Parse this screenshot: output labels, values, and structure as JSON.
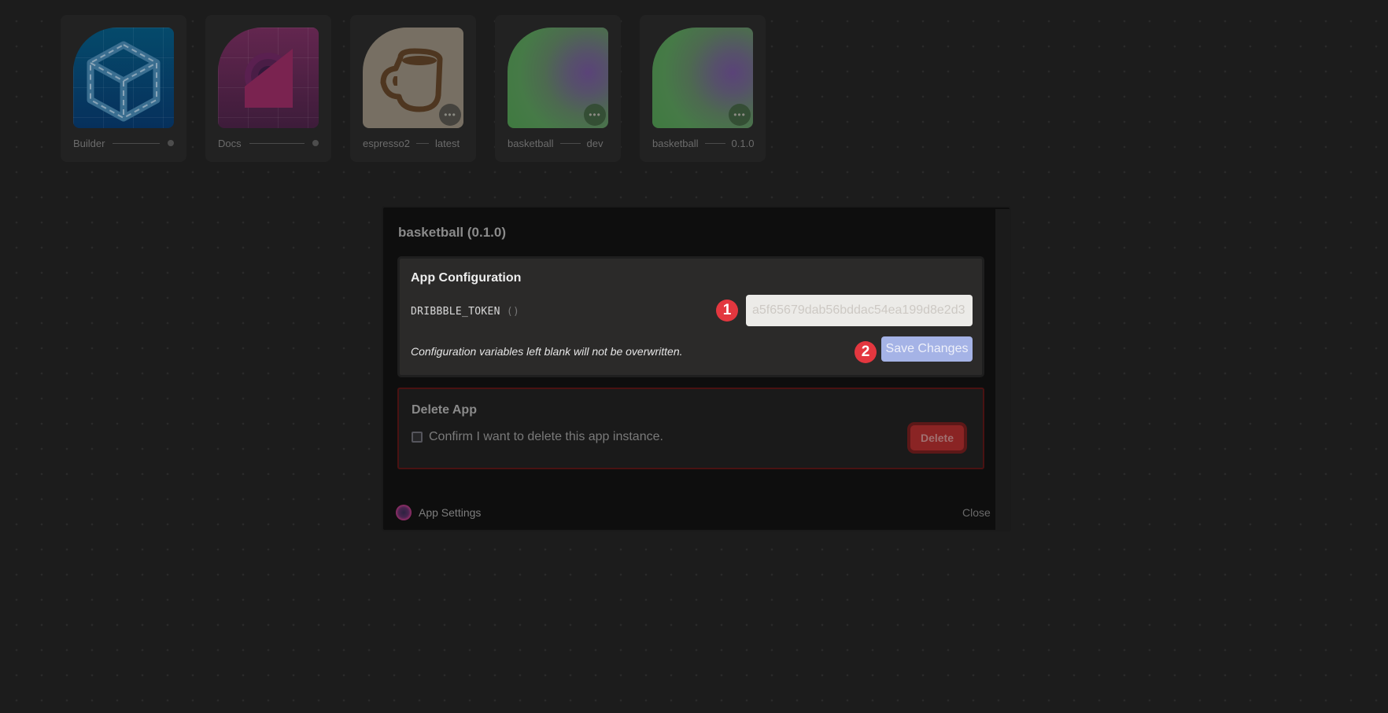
{
  "apps": [
    {
      "name": "Builder",
      "tag": "",
      "icon": "cube-icon",
      "has_menu": false
    },
    {
      "name": "Docs",
      "tag": "",
      "icon": "docs-icon",
      "has_menu": false
    },
    {
      "name": "espresso2",
      "tag": "latest",
      "icon": "coffee-cup-icon",
      "has_menu": true
    },
    {
      "name": "basketball",
      "tag": "dev",
      "icon": "gradient-blob-icon",
      "has_menu": true
    },
    {
      "name": "basketball",
      "tag": "0.1.0",
      "icon": "gradient-blob-icon",
      "has_menu": true
    }
  ],
  "more_button_glyph": "•••",
  "modal": {
    "title": "basketball (0.1.0)",
    "config": {
      "title": "App Configuration",
      "variables": [
        {
          "name": "DRIBBBLE_TOKEN",
          "suffix": "()",
          "value": "",
          "placeholder": "a5f65679dab56bddac54ea199d8e2d3"
        }
      ],
      "hint": "Configuration variables left blank will not be overwritten.",
      "save_label": "Save Changes"
    },
    "delete": {
      "title": "Delete App",
      "confirm_label": "Confirm I want to delete this app instance.",
      "confirm_checked": false,
      "button_label": "Delete"
    },
    "footer": {
      "label": "App Settings",
      "close_label": "Close"
    }
  },
  "annotations": {
    "badge_1": "1",
    "badge_2": "2"
  },
  "colors": {
    "background": "#1c1c1c",
    "save_button": "#a5b3e6",
    "delete_button": "#8a2424",
    "badge": "#e3373f"
  }
}
